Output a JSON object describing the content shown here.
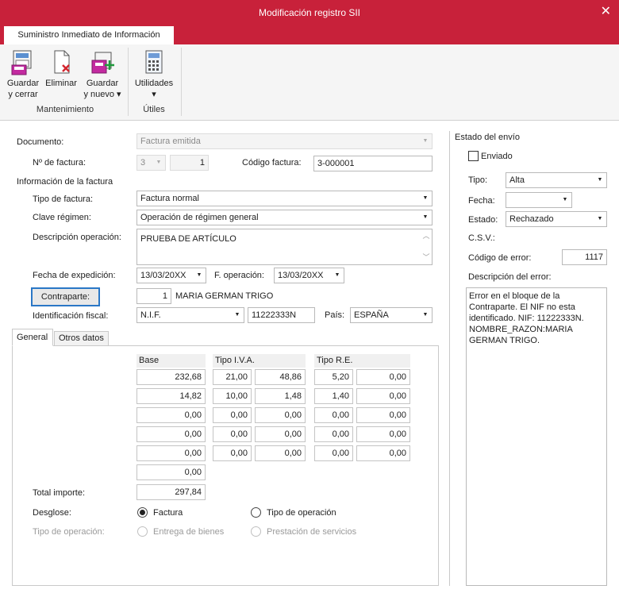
{
  "window": {
    "title": "Modificación registro SII",
    "close": "✕"
  },
  "ribbon": {
    "tab": "Suministro Inmediato de Información",
    "guardar_cerrar": [
      "Guardar",
      "y cerrar"
    ],
    "eliminar": "Eliminar",
    "guardar_nuevo": [
      "Guardar",
      "y nuevo ▾"
    ],
    "utilidades": [
      "Utilidades",
      "▾"
    ],
    "group_mantenimiento": "Mantenimiento",
    "group_utiles": "Útiles"
  },
  "form": {
    "documento_label": "Documento:",
    "documento_value": "Factura emitida",
    "nfactura_label": "Nº de factura:",
    "nfactura_serie": "3",
    "nfactura_num": "1",
    "codigo_factura_label": "Código factura:",
    "codigo_factura_value": "3-000001",
    "info_factura_label": "Información de la factura",
    "tipo_factura_label": "Tipo de factura:",
    "tipo_factura_value": "Factura normal",
    "clave_regimen_label": "Clave régimen:",
    "clave_regimen_value": "Operación de régimen general",
    "descripcion_label": "Descripción operación:",
    "descripcion_value": "PRUEBA DE ARTÍCULO",
    "fecha_expedicion_label": "Fecha de expedición:",
    "fecha_expedicion_value": "13/03/20XX",
    "f_operacion_label": "F. operación:",
    "f_operacion_value": "13/03/20XX",
    "contraparte_button": "Contraparte:",
    "contraparte_num": "1",
    "contraparte_name": "MARIA GERMAN TRIGO",
    "identificacion_label": "Identificación fiscal:",
    "identificacion_tipo": "N.I.F.",
    "identificacion_num": "11222333N",
    "pais_label": "País:",
    "pais_value": "ESPAÑA"
  },
  "tabs": {
    "general": "General",
    "otros": "Otros datos"
  },
  "grid": {
    "base_header": "Base",
    "iva_header": "Tipo I.V.A.",
    "re_header": "Tipo R.E.",
    "rows": [
      [
        "232,68",
        "21,00",
        "48,86",
        "5,20",
        "0,00"
      ],
      [
        "14,82",
        "10,00",
        "1,48",
        "1,40",
        "0,00"
      ],
      [
        "0,00",
        "0,00",
        "0,00",
        "0,00",
        "0,00"
      ],
      [
        "0,00",
        "0,00",
        "0,00",
        "0,00",
        "0,00"
      ],
      [
        "0,00",
        "0,00",
        "0,00",
        "0,00",
        "0,00"
      ]
    ],
    "extra_base": "0,00",
    "total_label": "Total importe:",
    "total_value": "297,84"
  },
  "desglose": {
    "label": "Desglose:",
    "factura": "Factura",
    "tipo_operacion": "Tipo de operación",
    "tipo_op_label": "Tipo de operación:",
    "entrega": "Entrega de bienes",
    "prestacion": "Prestación de servicios"
  },
  "envio": {
    "title": "Estado del envío",
    "enviado": "Enviado",
    "tipo_label": "Tipo:",
    "tipo_value": "Alta",
    "fecha_label": "Fecha:",
    "fecha_value": "",
    "estado_label": "Estado:",
    "estado_value": "Rechazado",
    "csv_label": "C.S.V.:",
    "codigo_error_label": "Código de error:",
    "codigo_error_value": "1117",
    "descripcion_error_label": "Descripción del error:",
    "descripcion_error_value": "Error en el bloque de la Contraparte. El NIF no esta identificado. NIF: 11222333N. NOMBRE_RAZON:MARIA GERMAN TRIGO."
  }
}
